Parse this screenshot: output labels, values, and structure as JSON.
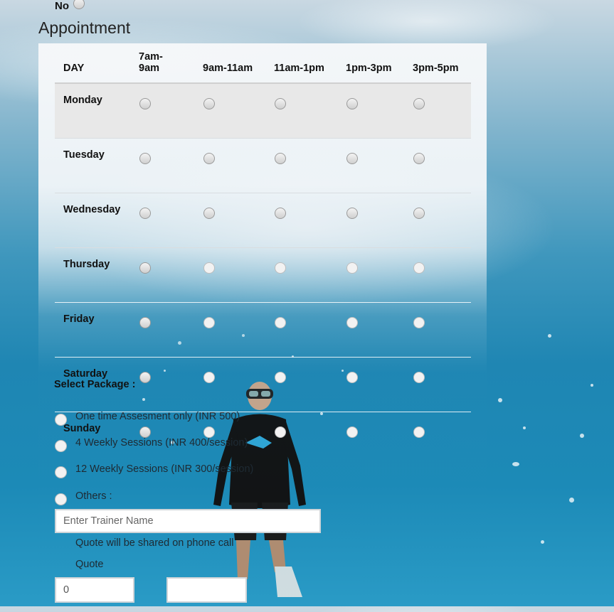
{
  "no_option": {
    "label": "No"
  },
  "section_title": "Appointment",
  "schedule": {
    "day_header": "DAY",
    "slots": [
      "7am-9am",
      "9am-11am",
      "11am-1pm",
      "1pm-3pm",
      "3pm-5pm"
    ],
    "slot_headers": [
      [
        "7am-",
        "9am"
      ],
      [
        "9am-11am"
      ],
      [
        "11am-1pm"
      ],
      [
        "1pm-3pm"
      ],
      [
        "3pm-5pm"
      ]
    ],
    "days": [
      "Monday",
      "Tuesday",
      "Wednesday",
      "Thursday",
      "Friday",
      "Saturday",
      "Sunday"
    ]
  },
  "package": {
    "label": "Select Package :",
    "options": [
      "One time Assesment only (INR 500)",
      "4 Weekly Sessions (INR 400/session)",
      "12 Weekly Sessions (INR 300/session)",
      "Others :"
    ],
    "trainer_placeholder": "Enter Trainer Name",
    "note": "Quote will be shared on phone call",
    "quote_label": "Quote",
    "quote_value": "0",
    "second_value": ""
  }
}
